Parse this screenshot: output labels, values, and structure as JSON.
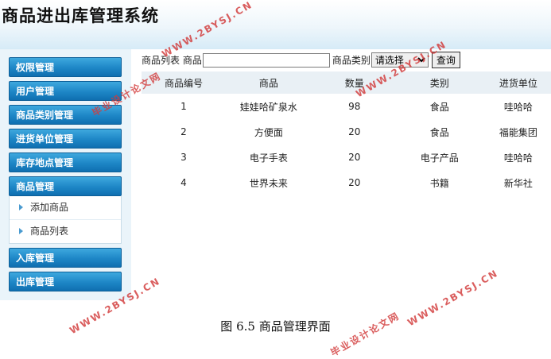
{
  "app": {
    "title": "商品进出库管理系统"
  },
  "sidebar": {
    "items": [
      {
        "label": "权限管理"
      },
      {
        "label": "用户管理"
      },
      {
        "label": "商品类别管理"
      },
      {
        "label": "进货单位管理"
      },
      {
        "label": "库存地点管理"
      },
      {
        "label": "商品管理"
      },
      {
        "label": "入库管理"
      },
      {
        "label": "出库管理"
      }
    ],
    "sub_items": [
      {
        "label": "添加商品"
      },
      {
        "label": "商品列表"
      }
    ]
  },
  "search": {
    "section_label": "商品列表",
    "name_label": "商品",
    "name_value": "",
    "category_label": "商品类别",
    "category_selected": "请选择",
    "button_label": "查询"
  },
  "table": {
    "headers": [
      "商品编号",
      "商品",
      "数量",
      "类别",
      "进货单位"
    ],
    "rows": [
      [
        "1",
        "娃娃哈矿泉水",
        "98",
        "食品",
        "哇哈哈"
      ],
      [
        "2",
        "方便面",
        "20",
        "食品",
        "福能集团"
      ],
      [
        "3",
        "电子手表",
        "20",
        "电子产品",
        "哇哈哈"
      ],
      [
        "4",
        "世界未来",
        "20",
        "书籍",
        "新华社"
      ]
    ]
  },
  "caption": "图 6.5  商品管理界面",
  "watermark": {
    "url": "WWW.2BYSJ.CN",
    "cn": "毕业设计论文网"
  },
  "colors": {
    "menu_blue": "#1d86c6",
    "header_bg": "#d6ebf7",
    "table_header_bg": "#e9f0f5",
    "watermark_red": "#d23b3b"
  }
}
